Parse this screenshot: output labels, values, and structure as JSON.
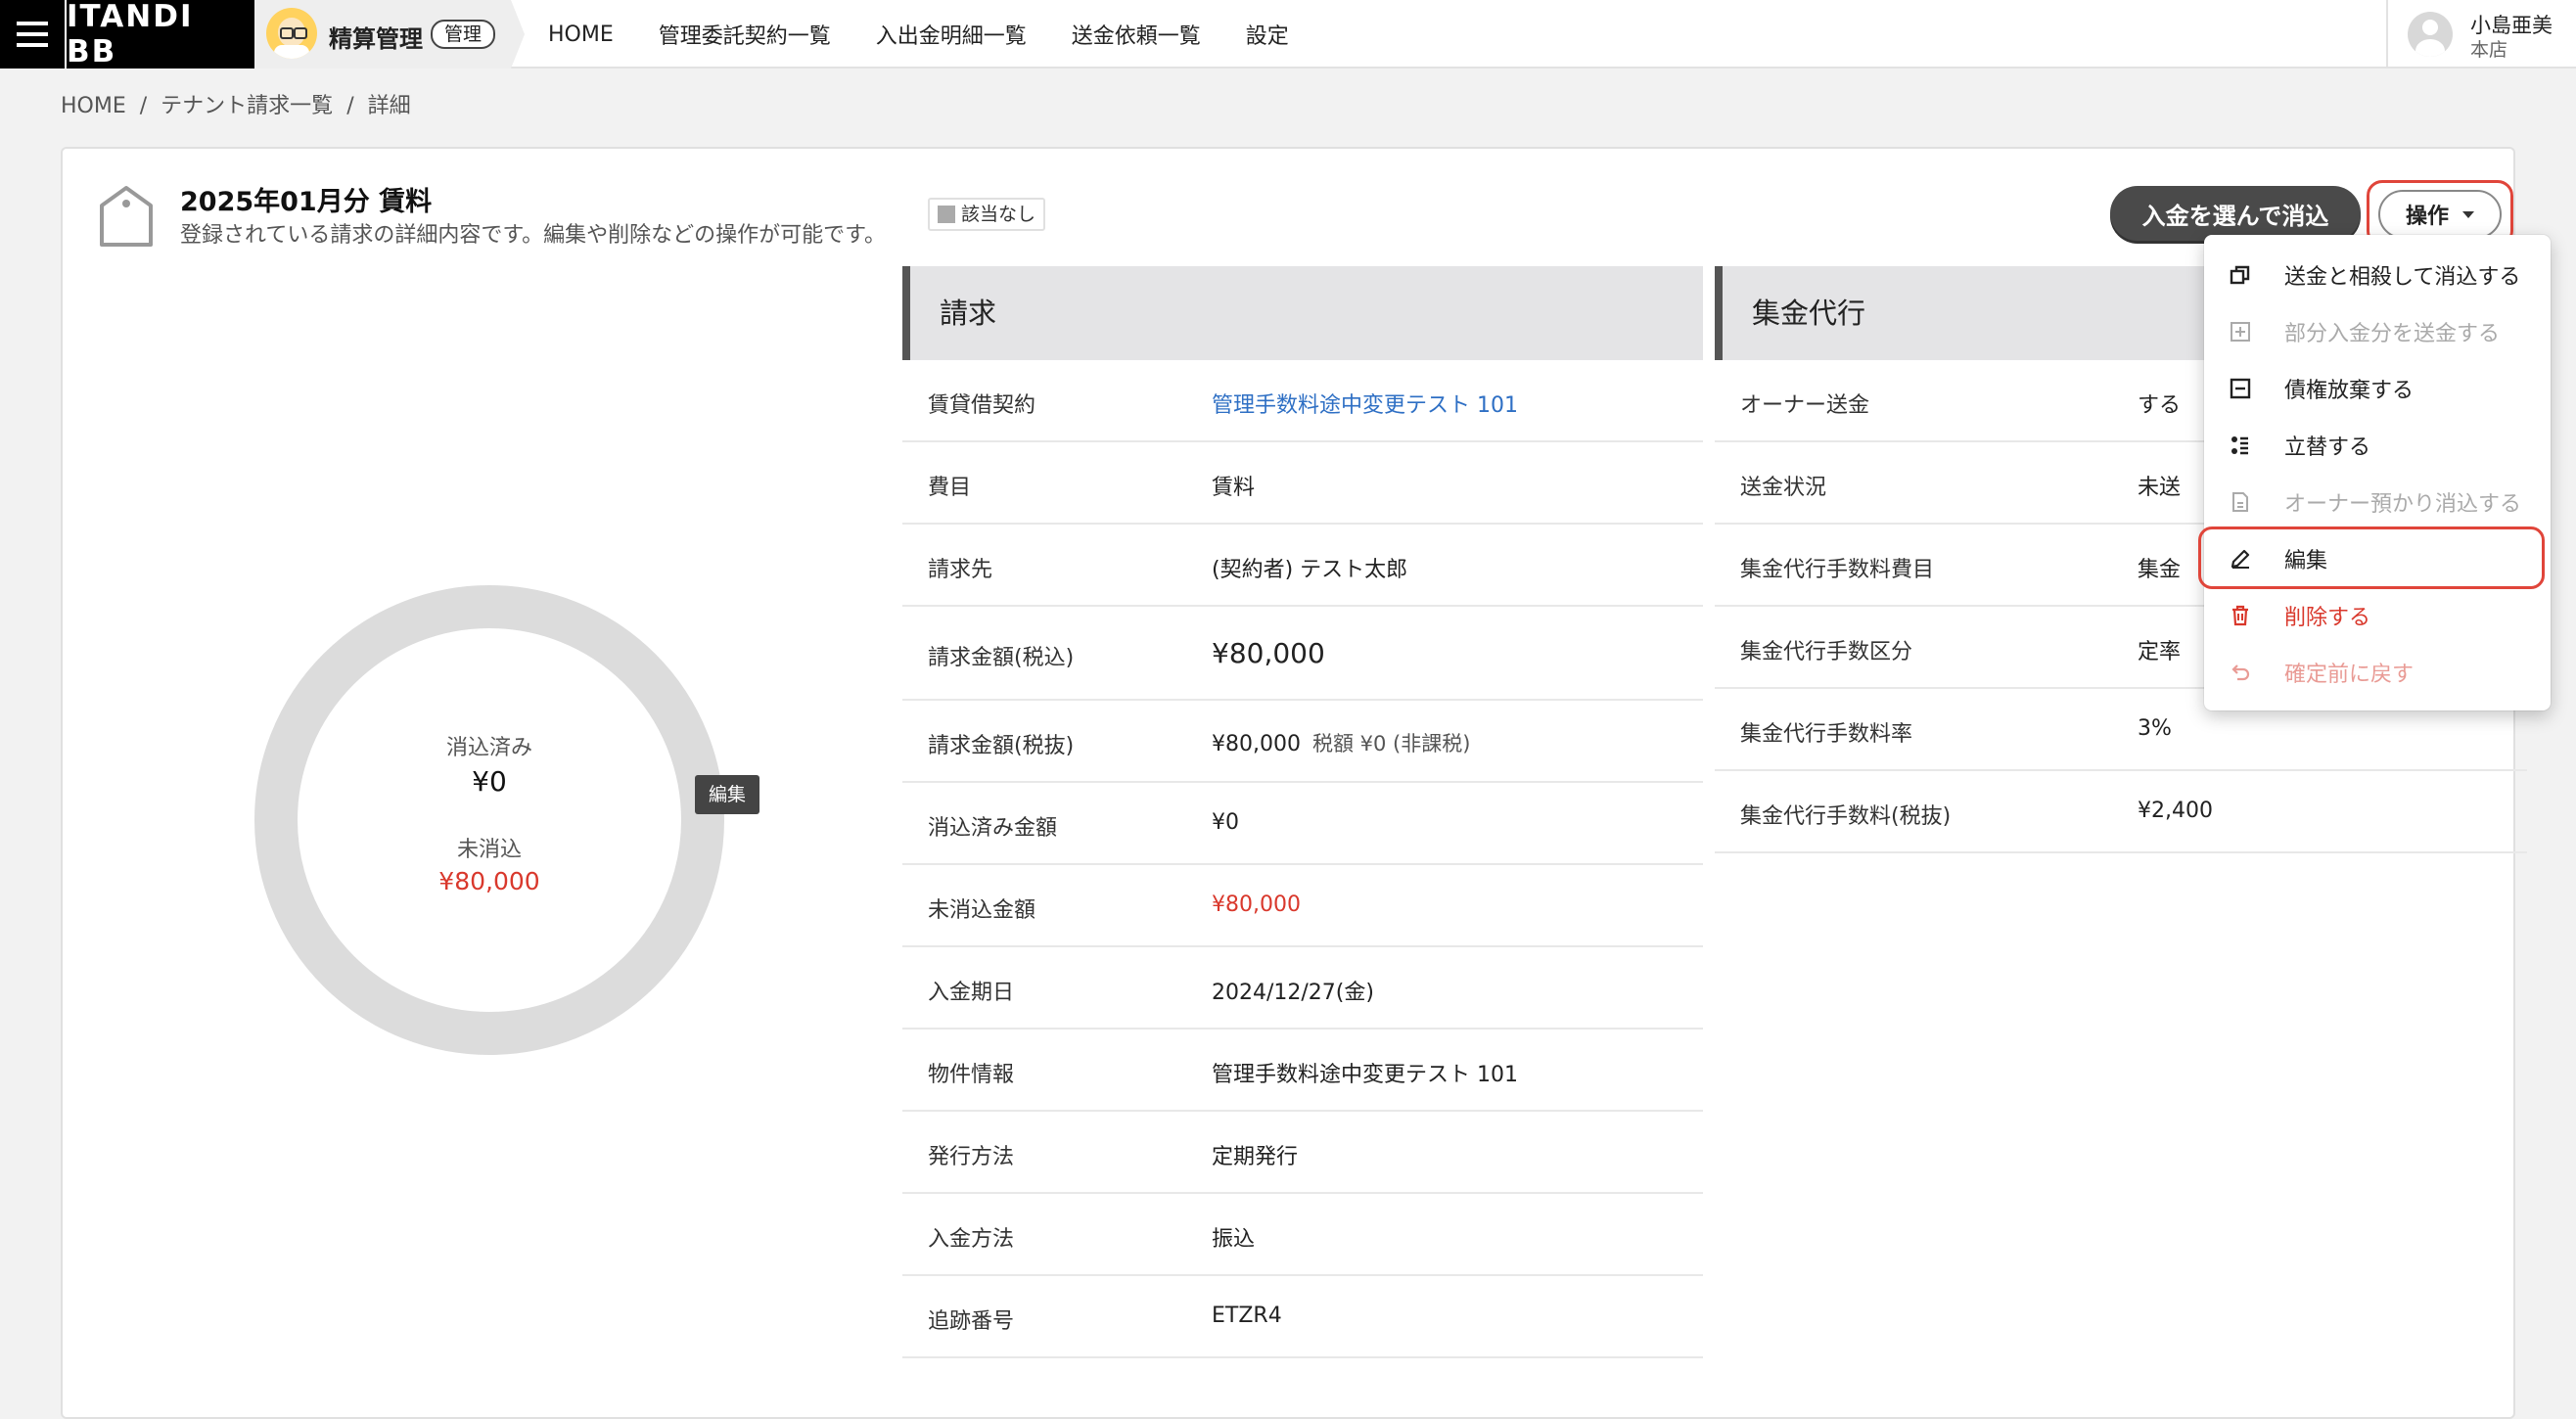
{
  "header": {
    "logo": "ITANDI BB",
    "app_name": "精算管理",
    "app_badge": "管理",
    "nav": [
      "HOME",
      "管理委託契約一覧",
      "入出金明細一覧",
      "送金依頼一覧",
      "設定"
    ],
    "user_name": "小島亜美",
    "user_branch": "本店"
  },
  "breadcrumb": [
    "HOME",
    "テナント請求一覧",
    "詳細"
  ],
  "page": {
    "title": "2025年01月分 賃料",
    "subtitle": "登録されている請求の詳細内容です。編集や削除などの操作が可能です。",
    "tag": "該当なし",
    "primary_button": "入金を選んで消込",
    "ops_button": "操作"
  },
  "donut": {
    "reconciled_label": "消込済み",
    "reconciled_value": "¥0",
    "unreconciled_label": "未消込",
    "unreconciled_value": "¥80,000",
    "edit_label": "編集",
    "reconciled_fraction": 0
  },
  "billing": {
    "title": "請求",
    "rows": [
      {
        "key": "賃貸借契約",
        "value": "管理手数料途中変更テスト 101",
        "style": "link"
      },
      {
        "key": "費目",
        "value": "賃料"
      },
      {
        "key": "請求先",
        "value": "(契約者) テスト太郎"
      },
      {
        "key": "請求金額(税込)",
        "value": "¥80,000",
        "style": "big"
      },
      {
        "key": "請求金額(税抜)",
        "value": "¥80,000",
        "note": "税額 ¥0 (非課税)"
      },
      {
        "key": "消込済み金額",
        "value": "¥0"
      },
      {
        "key": "未消込金額",
        "value": "¥80,000",
        "style": "red"
      },
      {
        "key": "入金期日",
        "value": "2024/12/27(金)"
      },
      {
        "key": "物件情報",
        "value": "管理手数料途中変更テスト 101"
      },
      {
        "key": "発行方法",
        "value": "定期発行"
      },
      {
        "key": "入金方法",
        "value": "振込"
      },
      {
        "key": "追跡番号",
        "value": "ETZR4"
      }
    ]
  },
  "collection": {
    "title": "集金代行",
    "rows": [
      {
        "key": "オーナー送金",
        "value": "する"
      },
      {
        "key": "送金状況",
        "value": "未送"
      },
      {
        "key": "集金代行手数料費目",
        "value": "集金"
      },
      {
        "key": "集金代行手数区分",
        "value": "定率"
      },
      {
        "key": "集金代行手数料率",
        "value": "3%"
      },
      {
        "key": "集金代行手数料(税抜)",
        "value": "¥2,400"
      }
    ]
  },
  "menu": {
    "items": [
      {
        "label": "送金と相殺して消込する",
        "icon": "copy-icon",
        "state": "normal"
      },
      {
        "label": "部分入金分を送金する",
        "icon": "plus-box-icon",
        "state": "disabled"
      },
      {
        "label": "債権放棄する",
        "icon": "minus-box-icon",
        "state": "normal"
      },
      {
        "label": "立替する",
        "icon": "transfer-icon",
        "state": "normal"
      },
      {
        "label": "オーナー預かり消込する",
        "icon": "document-icon",
        "state": "disabled"
      },
      {
        "label": "編集",
        "icon": "pencil-icon",
        "state": "normal"
      },
      {
        "label": "削除する",
        "icon": "trash-icon",
        "state": "danger"
      },
      {
        "label": "確定前に戻す",
        "icon": "undo-icon",
        "state": "danger-disabled"
      }
    ]
  },
  "colors": {
    "accent_link": "#2e6fc4",
    "danger": "#d9382c",
    "highlight": "#e0453a"
  }
}
